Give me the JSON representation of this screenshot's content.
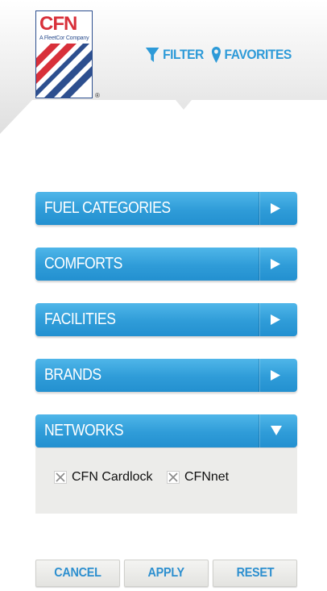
{
  "header": {
    "logo_text": "CFN",
    "logo_sub": "A FleetCor Company",
    "logo_reg": "®",
    "filter_label": "FILTER",
    "favorites_label": "FAVORITES",
    "filter_icon": "filter-icon",
    "favorites_icon": "map-pin-icon"
  },
  "accordion": [
    {
      "label": "FUEL CATEGORIES",
      "state": "collapsed"
    },
    {
      "label": "COMFORTS",
      "state": "collapsed"
    },
    {
      "label": "FACILITIES",
      "state": "collapsed"
    },
    {
      "label": "BRANDS",
      "state": "collapsed"
    },
    {
      "label": "NETWORKS",
      "state": "expanded"
    }
  ],
  "networks": {
    "options": [
      {
        "label": "CFN Cardlock",
        "checked": false
      },
      {
        "label": "CFNnet",
        "checked": false
      }
    ]
  },
  "actions": {
    "cancel": "CANCEL",
    "apply": "APPLY",
    "reset": "RESET"
  },
  "colors": {
    "accent": "#2d9ad8",
    "bar": "#2f9cd8",
    "logo_red": "#d8303a",
    "logo_blue": "#2d4f8f"
  }
}
